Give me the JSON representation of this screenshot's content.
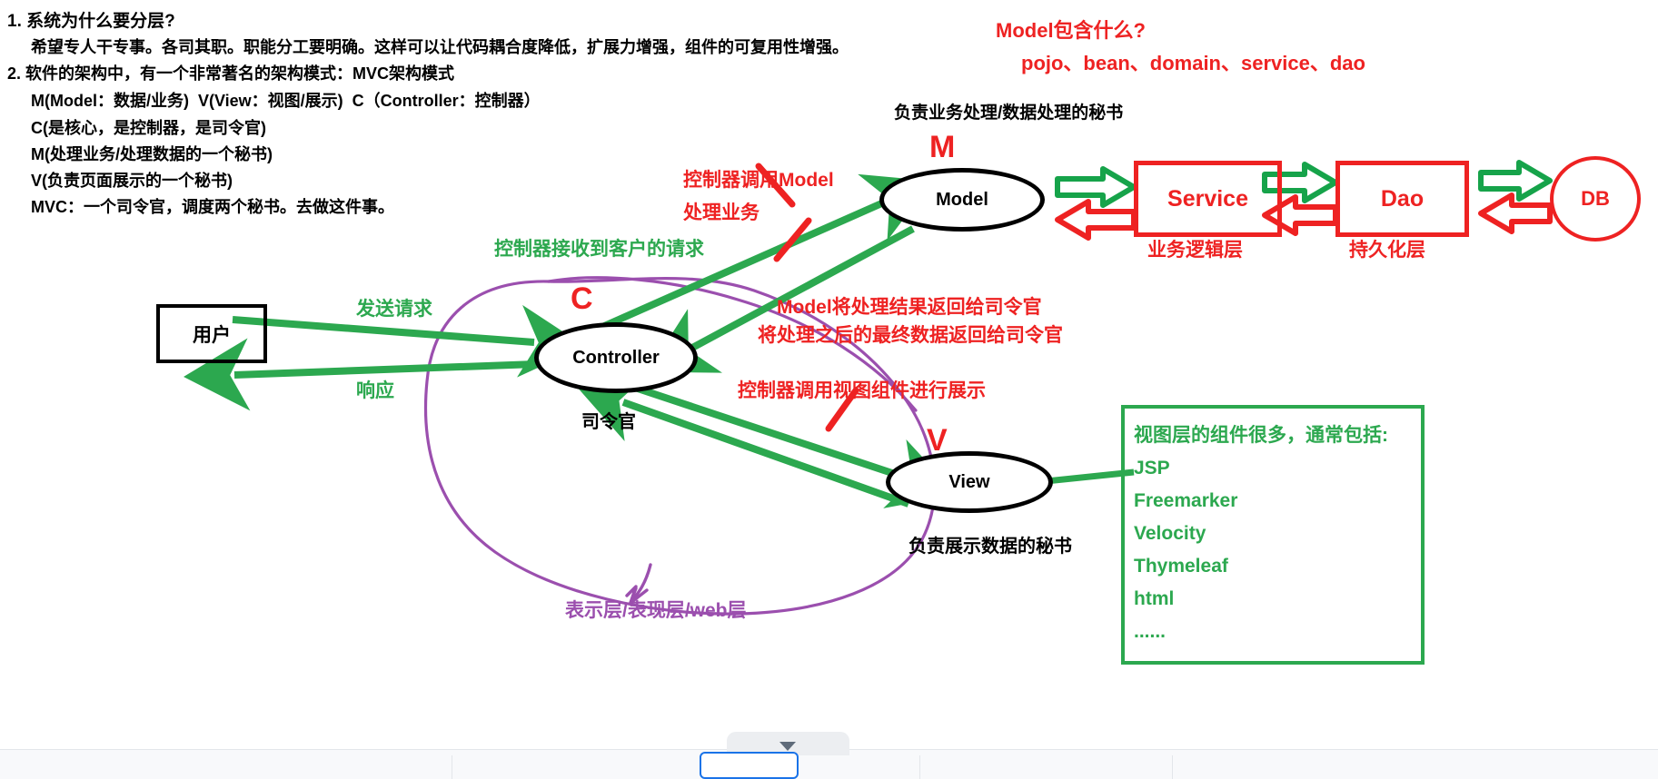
{
  "notes": {
    "lines": [
      "1. 系统为什么要分层?",
      "希望专人干专事。各司其职。职能分工要明确。这样可以让代码耦合度降低，扩展力增强，组件的可复用性增强。",
      "2. 软件的架构中，有一个非常著名的架构模式：MVC架构模式",
      "M(Model：数据/业务)  V(View：视图/展示)  C（Controller：控制器）",
      "C(是核心，是控制器，是司令官)",
      "M(处理业务/处理数据的一个秘书)",
      "V(负责页面展示的一个秘书)",
      "MVC：一个司令官，调度两个秘书。去做这件事。"
    ]
  },
  "model_contains": {
    "question": "Model包含什么?",
    "answer": "pojo、bean、domain、service、dao"
  },
  "nodes": {
    "user": "用户",
    "controller": "Controller",
    "model": "Model",
    "view": "View",
    "service": "Service",
    "dao": "Dao",
    "db": "DB"
  },
  "marks": {
    "m": "M",
    "c": "C",
    "v": "V"
  },
  "captions": {
    "model_caption": "负责业务处理/数据处理的秘书",
    "controller_caption": "司令官",
    "view_caption": "负责展示数据的秘书",
    "service_layer": "业务逻辑层",
    "dao_layer": "持久化层",
    "presentation_layer": "表示层/表现层/web层"
  },
  "annotations": {
    "send_request": "发送请求",
    "response": "响应",
    "controller_receives": "控制器接收到客户的请求",
    "controller_calls_model_1": "控制器调用Model",
    "controller_calls_model_2": "处理业务",
    "model_returns_1": "Model将处理结果返回给司令官",
    "model_returns_2": "将处理之后的最终数据返回给司令官",
    "controller_calls_view": "控制器调用视图组件进行展示"
  },
  "view_components": {
    "title": "视图层的组件很多，通常包括:",
    "items": [
      "JSP",
      "Freemarker",
      "Velocity",
      "Thymeleaf",
      "html",
      "......"
    ]
  },
  "colors": {
    "red": "#ee2222",
    "green": "#2ca84f",
    "purple": "#9b4fae",
    "black": "#000000"
  }
}
